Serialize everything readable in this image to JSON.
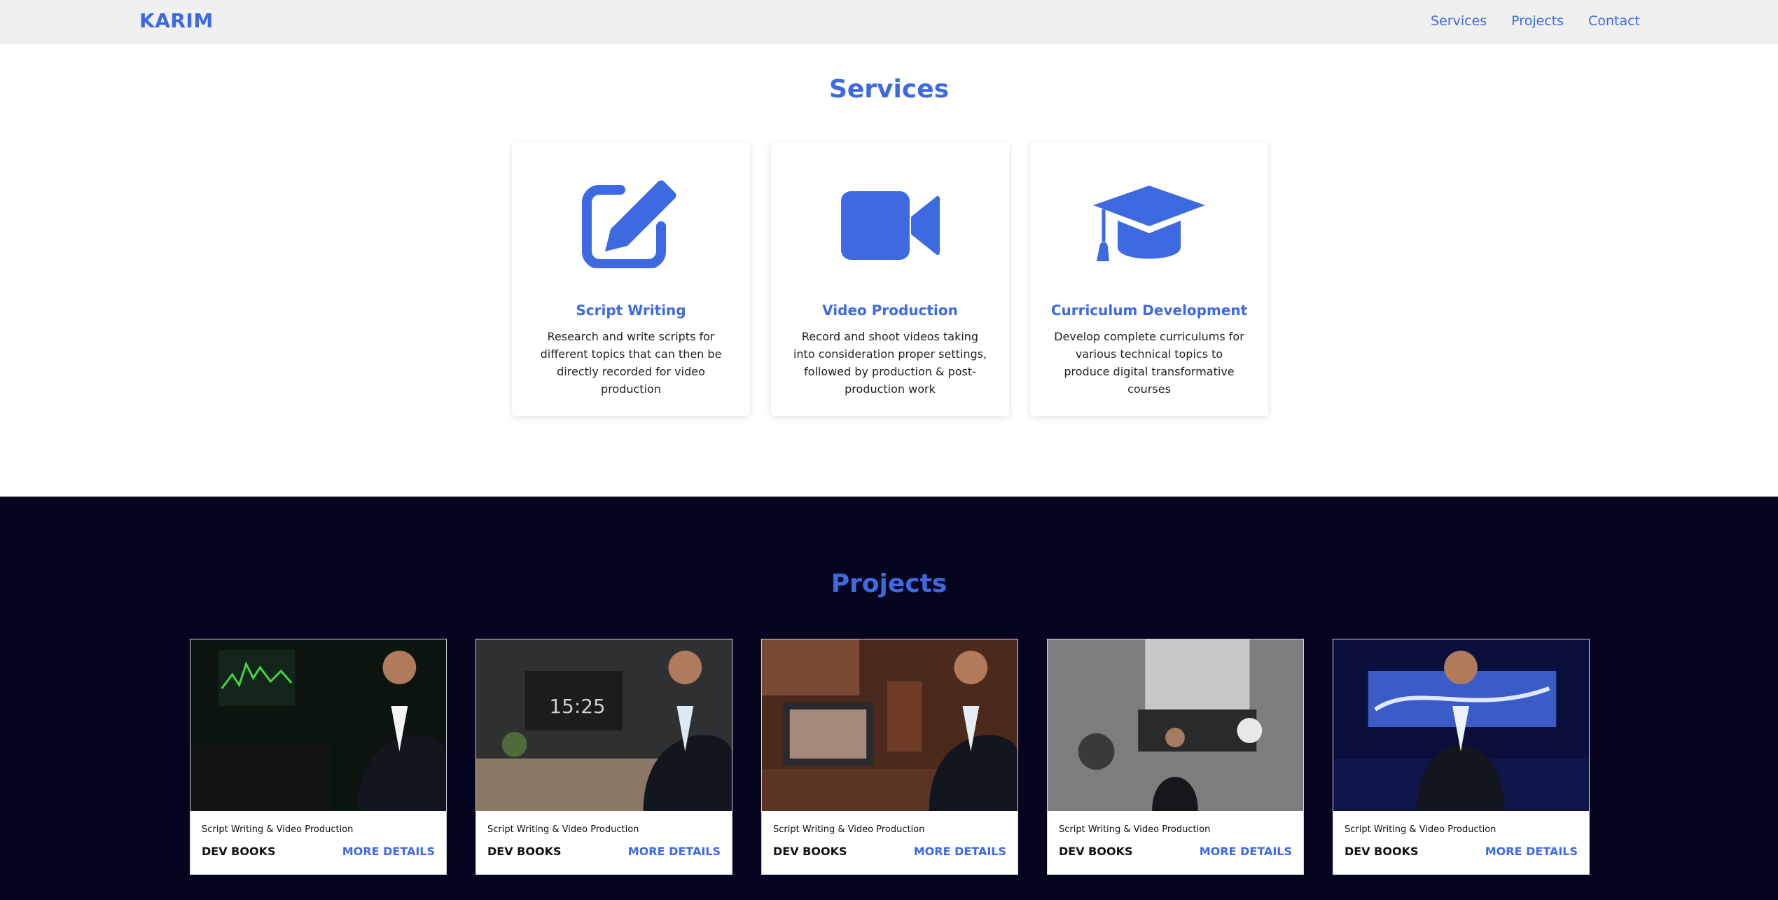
{
  "header": {
    "brand": "KARIM",
    "nav": [
      "Services",
      "Projects",
      "Contact"
    ]
  },
  "services": {
    "title": "Services",
    "items": [
      {
        "icon": "edit-icon",
        "title": "Script Writing",
        "description": "Research and write scripts for different topics that can then be directly recorded for video production"
      },
      {
        "icon": "video-camera-icon",
        "title": "Video Production",
        "description": "Record and shoot videos taking into consideration proper settings, followed by production & post-production work"
      },
      {
        "icon": "graduation-cap-icon",
        "title": "Curriculum Development",
        "description": "Develop complete curriculums for various technical topics to produce digital transformative courses"
      }
    ]
  },
  "projects": {
    "title": "Projects",
    "items": [
      {
        "category": "Script Writing & Video Production",
        "name": "DEV BOOKS",
        "link": "MORE DETAILS"
      },
      {
        "category": "Script Writing & Video Production",
        "name": "DEV BOOKS",
        "link": "MORE DETAILS"
      },
      {
        "category": "Script Writing & Video Production",
        "name": "DEV BOOKS",
        "link": "MORE DETAILS"
      },
      {
        "category": "Script Writing & Video Production",
        "name": "DEV BOOKS",
        "link": "MORE DETAILS"
      },
      {
        "category": "Script Writing & Video Production",
        "name": "DEV BOOKS",
        "link": "MORE DETAILS"
      }
    ],
    "thumb_overlay_text": "15:25"
  },
  "colors": {
    "accent": "#3e6ae1",
    "header_bg": "#f0f0f0",
    "projects_bg": "#050520"
  }
}
